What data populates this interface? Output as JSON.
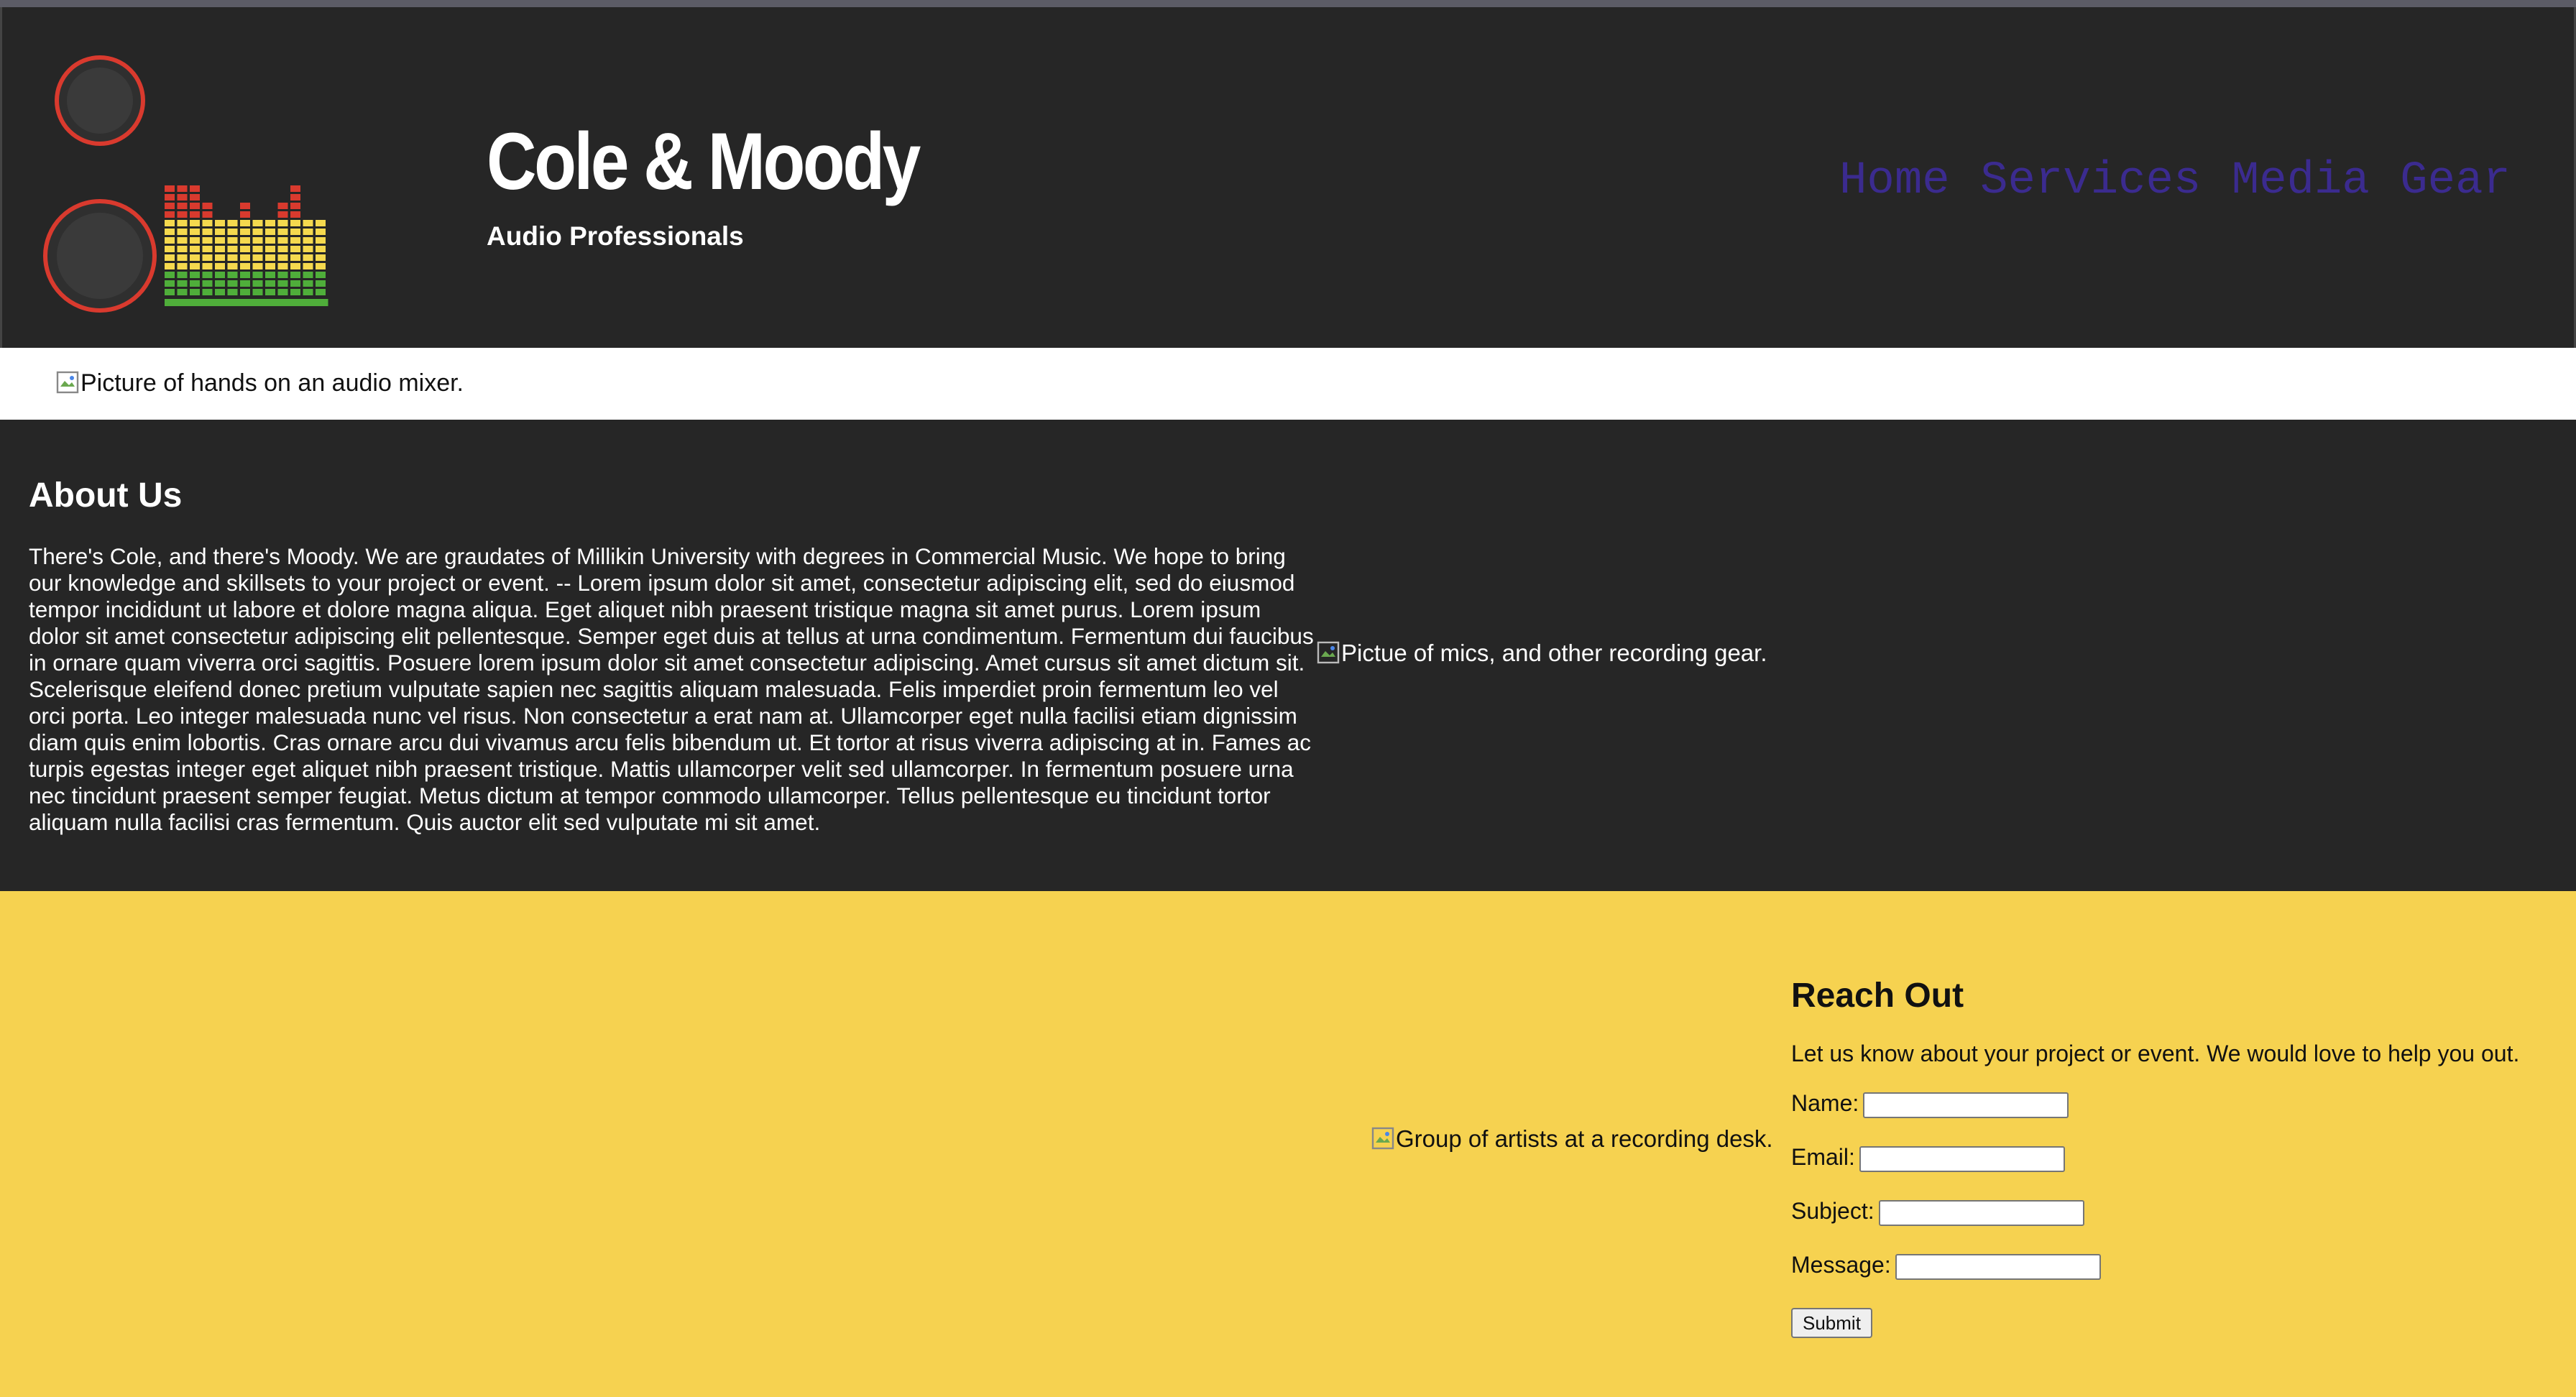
{
  "brand": {
    "title": "Cole & Moody",
    "tagline": "Audio Professionals"
  },
  "nav": {
    "items": [
      "Home",
      "Services",
      "Media",
      "Gear"
    ]
  },
  "banner": {
    "image_alt": "Picture of hands on an audio mixer."
  },
  "about": {
    "heading": "About Us",
    "body": "There's Cole, and there's Moody. We are graudates of Millikin University with degrees in Commercial Music. We hope to bring our knowledge and skillsets to your project or event. -- Lorem ipsum dolor sit amet, consectetur adipiscing elit, sed do eiusmod tempor incididunt ut labore et dolore magna aliqua. Eget aliquet nibh praesent tristique magna sit amet purus. Lorem ipsum dolor sit amet consectetur adipiscing elit pellentesque. Semper eget duis at tellus at urna condimentum. Fermentum dui faucibus in ornare quam viverra orci sagittis. Posuere lorem ipsum dolor sit amet consectetur adipiscing. Amet cursus sit amet dictum sit. Scelerisque eleifend donec pretium vulputate sapien nec sagittis aliquam malesuada. Felis imperdiet proin fermentum leo vel orci porta. Leo integer malesuada nunc vel risus. Non consectetur a erat nam at. Ullamcorper eget nulla facilisi etiam dignissim diam quis enim lobortis. Cras ornare arcu dui vivamus arcu felis bibendum ut. Et tortor at risus viverra adipiscing at in. Fames ac turpis egestas integer eget aliquet nibh praesent tristique. Mattis ullamcorper velit sed ullamcorper. In fermentum posuere urna nec tincidunt praesent semper feugiat. Metus dictum at tempor commodo ullamcorper. Tellus pellentesque eu tincidunt tortor aliquam nulla facilisi cras fermentum. Quis auctor elit sed vulputate mi sit amet.",
    "image_alt": "Pictue of mics, and other recording gear."
  },
  "reach": {
    "image_alt": "Group of artists at a recording desk.",
    "heading": "Reach Out",
    "intro": "Let us know about your project or event. We would love to help you out.",
    "fields": {
      "name_label": "Name:",
      "email_label": "Email:",
      "subject_label": "Subject:",
      "message_label": "Message:"
    },
    "submit_label": "Submit"
  },
  "colors": {
    "header_bg": "#262626",
    "accent_yellow": "#f6d250",
    "nav_link": "#3b2b8f",
    "logo_red": "#d93a2e",
    "logo_yellow": "#f5d94e",
    "logo_green": "#4fae3a"
  },
  "icons": {
    "broken_image": "broken-image-icon",
    "speakers": "speaker-icon"
  }
}
